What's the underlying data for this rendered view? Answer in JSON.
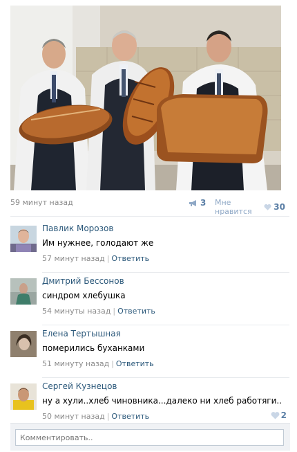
{
  "post": {
    "time": "59 минут назад",
    "shares": "3",
    "like_label": "Мне нравится",
    "likes": "30"
  },
  "comments": [
    {
      "author": "Павлик Морозов",
      "text": "Им нужнее, голодают же",
      "time": "57 минут назад",
      "reply": "Ответить",
      "likes": ""
    },
    {
      "author": "Дмитрий Бессонов",
      "text": "синдром хлебушка",
      "time": "54 минуты назад",
      "reply": "Ответить",
      "likes": ""
    },
    {
      "author": "Елена Тертышная",
      "text": "померились буханками",
      "time": "51 минуту назад",
      "reply": "Ответить",
      "likes": ""
    },
    {
      "author": "Сергей Кузнецов",
      "text": "ну а хули..хлеб чиновника...далеко ни хлеб работяги..",
      "time": "50 минут назад",
      "reply": "Ответить",
      "likes": "2"
    }
  ],
  "comment_box": {
    "placeholder": "Комментировать.."
  },
  "colors": {
    "link": "#2b587a",
    "count": "#5b7fa6",
    "muted": "#8a8a8a"
  }
}
